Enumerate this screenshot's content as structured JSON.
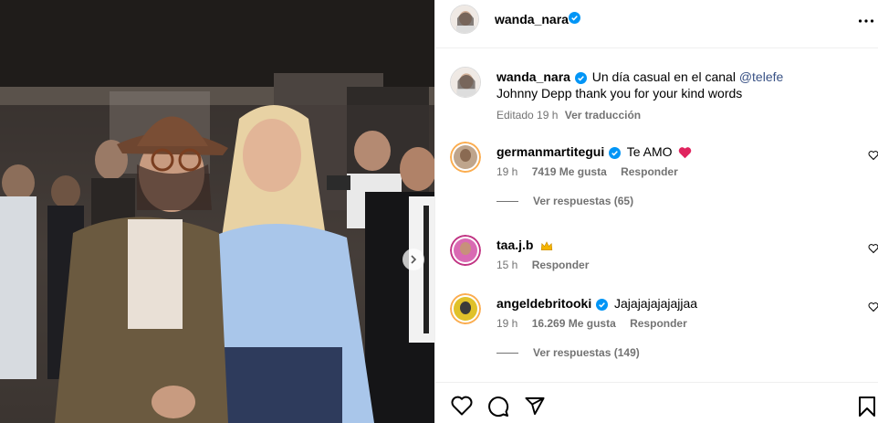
{
  "post": {
    "author": "wanda_nara",
    "caption_text": "Un día casual en el canal",
    "caption_mention": "@telefe",
    "caption_line2": "Johnny Depp thank you for your kind words",
    "edited_label": "Editado",
    "edited_time": "19 h",
    "translate_label": "Ver traducción"
  },
  "comments": [
    {
      "user": "germanmartitegui",
      "verified": true,
      "text": "Te AMO",
      "emoji": "heart",
      "time": "19 h",
      "likes": "7419 Me gusta",
      "reply_label": "Responder",
      "view_replies": "Ver respuestas (65)"
    },
    {
      "user": "taa.j.b",
      "verified": false,
      "text": "",
      "emoji": "crown",
      "time": "15 h",
      "likes": "",
      "reply_label": "Responder",
      "view_replies": ""
    },
    {
      "user": "angeldebritooki",
      "verified": true,
      "text": "Jajajajajajajjaa",
      "emoji": "",
      "time": "19 h",
      "likes": "16.269 Me gusta",
      "reply_label": "Responder",
      "view_replies": "Ver respuestas (149)"
    }
  ],
  "icons": {
    "more": "more-horizontal-icon",
    "like": "heart-icon",
    "comment": "comment-icon",
    "share": "send-icon",
    "save": "bookmark-icon",
    "verified": "verified-badge-icon",
    "next": "chevron-right-icon"
  },
  "colors": {
    "verified": "#0095f6",
    "mention": "#385185",
    "meta": "#737373",
    "heart_emoji": "#e0245e"
  }
}
